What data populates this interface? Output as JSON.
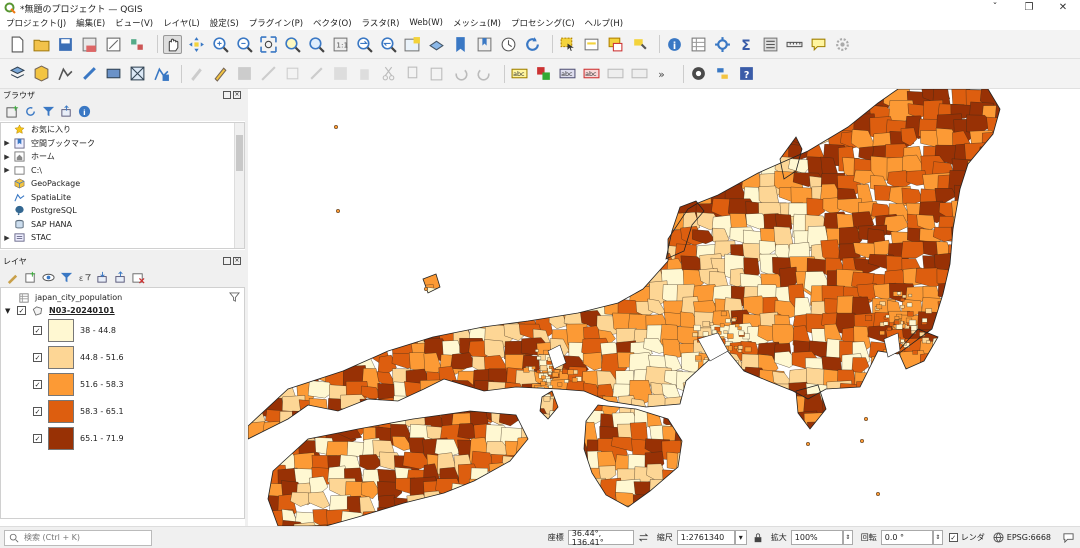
{
  "window": {
    "title": "*無題のプロジェクト — QGIS",
    "controls": [
      "ˇ",
      "❐",
      "✕"
    ]
  },
  "menu": [
    "プロジェクト(J)",
    "編集(E)",
    "ビュー(V)",
    "レイヤ(L)",
    "設定(S)",
    "プラグイン(P)",
    "ベクタ(O)",
    "ラスタ(R)",
    "Web(W)",
    "メッシュ(M)",
    "プロセシング(C)",
    "ヘルプ(H)"
  ],
  "browser": {
    "title": "ブラウザ",
    "items": [
      {
        "label": "お気に入り",
        "icon": "star-icon",
        "expand": false
      },
      {
        "label": "空間ブックマーク",
        "icon": "bookmark-icon",
        "expand": true
      },
      {
        "label": "ホーム",
        "icon": "home-icon",
        "expand": true
      },
      {
        "label": "C:\\",
        "icon": "drive-icon",
        "expand": true
      },
      {
        "label": "GeoPackage",
        "icon": "geopackage-icon",
        "expand": false
      },
      {
        "label": "SpatiaLite",
        "icon": "spatialite-icon",
        "expand": false
      },
      {
        "label": "PostgreSQL",
        "icon": "postgresql-icon",
        "expand": false
      },
      {
        "label": "SAP HANA",
        "icon": "saphana-icon",
        "expand": false
      },
      {
        "label": "STAC",
        "icon": "stac-icon",
        "expand": true
      }
    ]
  },
  "layers": {
    "title": "レイヤ",
    "table_layer": "japan_city_population",
    "vector_layer": "N03-20240101",
    "legend": [
      {
        "label": "38 - 44.8",
        "color": "#fff8d2"
      },
      {
        "label": "44.8 - 51.6",
        "color": "#fdd695"
      },
      {
        "label": "51.6 - 58.3",
        "color": "#fc9a35"
      },
      {
        "label": "58.3 - 65.1",
        "color": "#dd5e0f"
      },
      {
        "label": "65.1 - 71.9",
        "color": "#983105"
      }
    ]
  },
  "status": {
    "locator_placeholder": "検索 (Ctrl + K)",
    "coord_label": "座標",
    "coord_value": "36.44°, 136.41°",
    "scale_label": "縮尺",
    "scale_value": "1:2761340",
    "magnifier_label": "拡大",
    "magnifier_value": "100%",
    "rotation_label": "回転",
    "rotation_value": "0.0 °",
    "render_label": "レンダ",
    "crs": "EPSG:6668"
  }
}
